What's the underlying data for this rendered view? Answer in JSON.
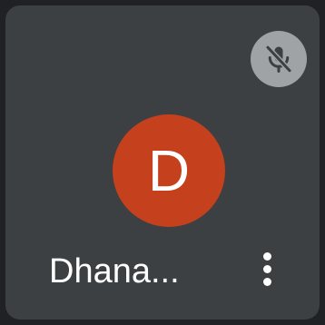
{
  "participant": {
    "name": "Dhana...",
    "initial": "D",
    "avatar_color": "#c5401c",
    "muted": true
  },
  "icons": {
    "mute": "mic-off-icon",
    "menu": "more-vertical-icon"
  },
  "colors": {
    "tile_background": "#3c4043",
    "mute_badge": "#a0a3a6"
  }
}
